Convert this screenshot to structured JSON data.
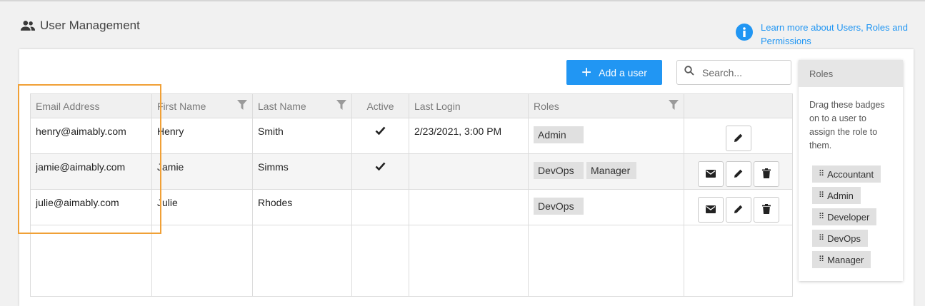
{
  "header": {
    "title": "User Management",
    "help_link": "Learn more about Users, Roles and Permissions"
  },
  "toolbar": {
    "add_label": "Add a user",
    "search_placeholder": "Search..."
  },
  "columns": [
    "Email Address",
    "First Name",
    "Last Name",
    "Active",
    "Last Login",
    "Roles",
    ""
  ],
  "users": [
    {
      "email": "henry@aimably.com",
      "first": "Henry",
      "last": "Smith",
      "active": true,
      "last_login": "2/23/2021, 3:00 PM",
      "roles": [
        "Admin"
      ]
    },
    {
      "email": "jamie@aimably.com",
      "first": "Jamie",
      "last": "Simms",
      "active": true,
      "last_login": "",
      "roles": [
        "DevOps",
        "Manager"
      ]
    },
    {
      "email": "julie@aimably.com",
      "first": "Julie",
      "last": "Rhodes",
      "active": false,
      "last_login": "",
      "roles": [
        "DevOps"
      ]
    }
  ],
  "roles_panel": {
    "title": "Roles",
    "description": "Drag these badges on to a user to assign the role to them.",
    "roles": [
      "Accountant",
      "Admin",
      "Developer",
      "DevOps",
      "Manager"
    ]
  },
  "colors": {
    "accent": "#2196f3",
    "highlight": "#f0a036"
  },
  "icons": [
    "users-icon",
    "info-icon",
    "plus-icon",
    "search-icon",
    "filter-icon",
    "check-icon",
    "mail-icon",
    "edit-icon",
    "delete-icon",
    "grip-icon"
  ]
}
